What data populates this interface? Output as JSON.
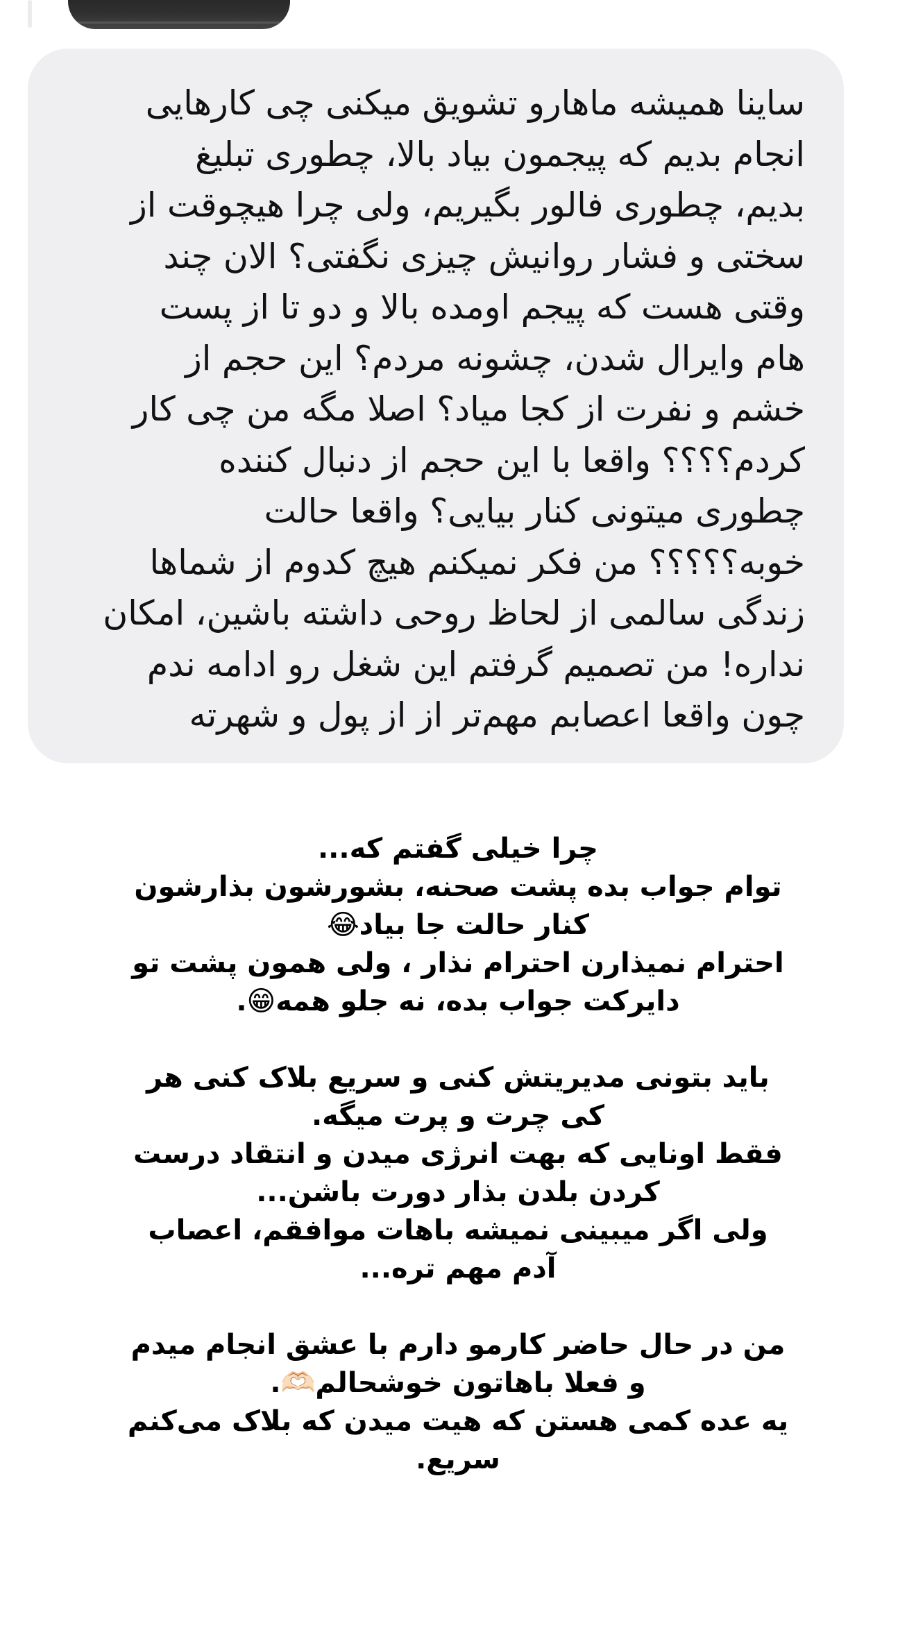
{
  "previous_message": {
    "thumbnail_icon": "video-thumbnail"
  },
  "message": {
    "lines": [
      "ساینا همیشه ماهارو تشویق میکنی چی کارهایی",
      "انجام بدیم که پیجمون بیاد بالا، چطوری تبلیغ",
      "بدیم، چطوری فالور بگیریم، ولی چرا هیچوقت از",
      "سختی و فشار روانیش چیزی نگفتی؟ الان چند",
      "وقتی هست که پیجم اومده بالا و دو تا از پست",
      "هام وایرال شدن، چشونه مردم؟ این حجم از",
      "خشم و نفرت از کجا میاد؟ اصلا مگه من چی کار",
      "کردم؟؟؟؟ واقعا با این حجم از دنبال کننده",
      "چطوری میتونی کنار بیایی؟ واقعا حالت",
      "خوبه؟؟؟؟؟ من فکر نمیکنم هیچ کدوم از شماها",
      "زندگی سالمی از لحاظ روحی داشته باشین، امکان",
      "نداره! من تصمیم گرفتم این شغل رو ادامه ندم",
      "چون واقعا اعصابم مهم‌تر از از پول و شهرته"
    ]
  },
  "reply": {
    "p1": [
      "چرا خیلی گفتم که...",
      "توام جواب بده پشت صحنه، بشورشون بذارشون",
      "کنار حالت جا بیاد😂",
      "احترام نمیذارن احترام نذار ، ولی همون پشت تو",
      "دایرکت جواب بده، نه جلو همه😁."
    ],
    "p2": [
      "باید بتونی مدیریتش کنی و سریع بلاک کنی هر",
      "کی چرت و پرت میگه.",
      "فقط اونایی که بهت انرژی میدن و انتقاد درست",
      "کردن بلدن بذار دورت باشن...",
      "ولی اگر میبینی نمیشه باهات موافقم، اعصاب",
      "آدم مهم تره..."
    ],
    "p3": [
      "من در حال حاضر کارمو دارم با عشق انجام میدم",
      "و فعلا باهاتون خوشحالم🫶🏻.",
      "یه عده کمی هستن که هیت میدن که بلاک می‌کنم",
      "سریع."
    ]
  }
}
